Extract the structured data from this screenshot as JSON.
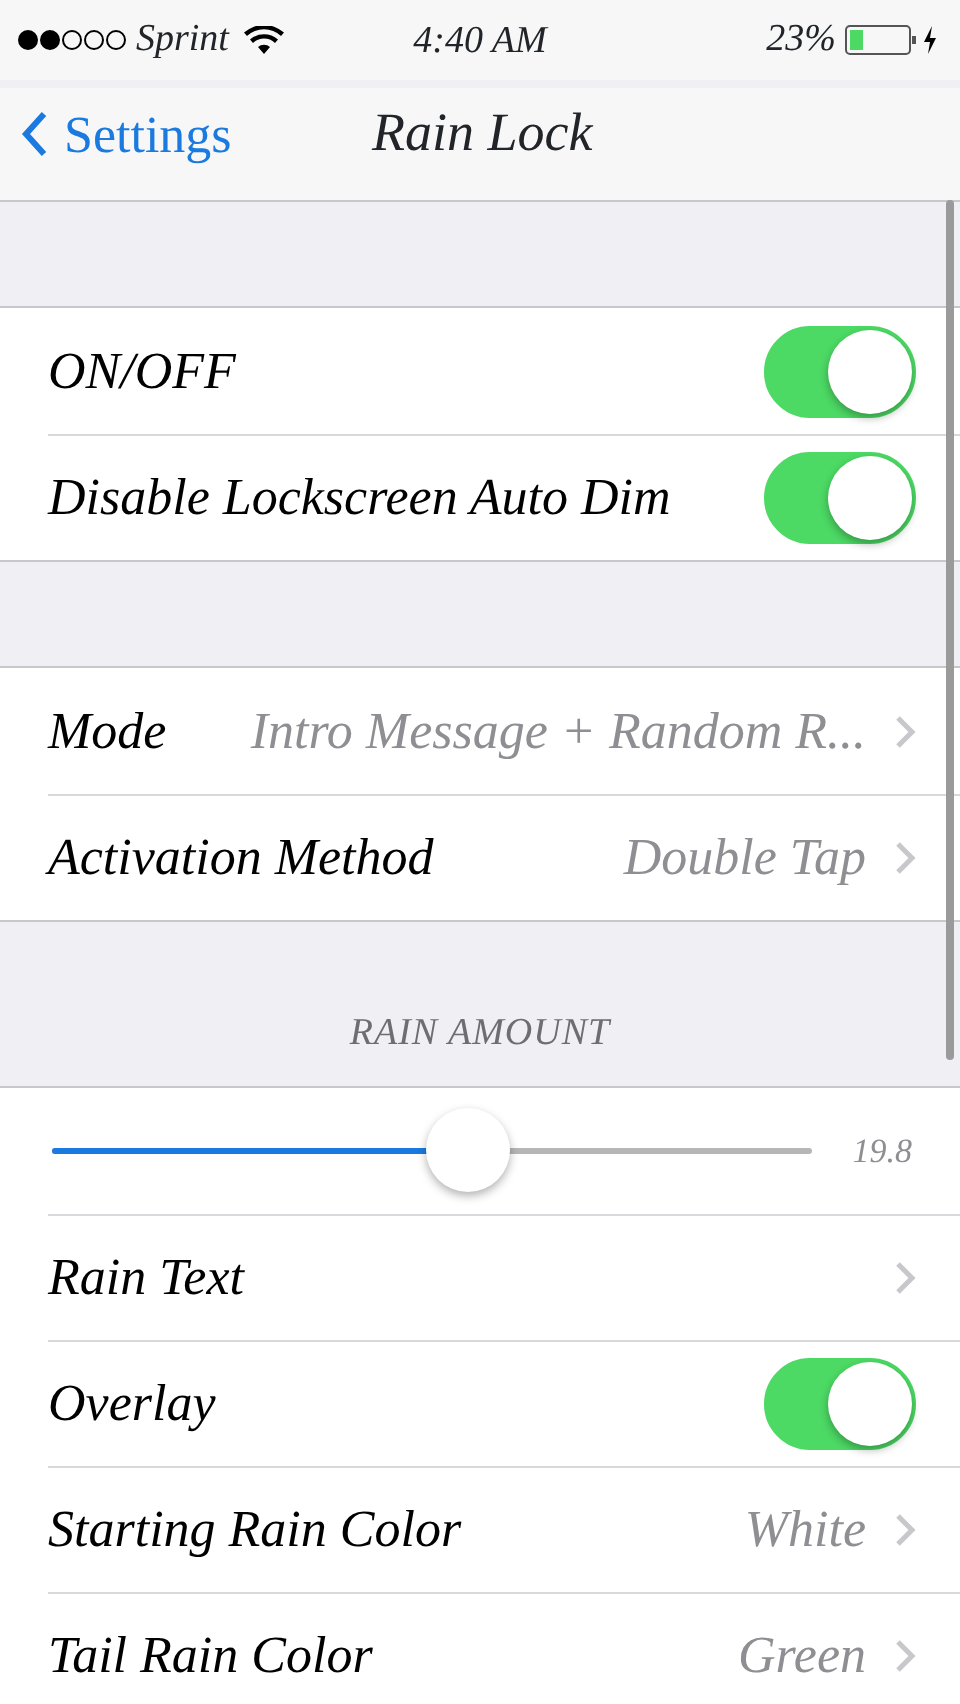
{
  "status_bar": {
    "carrier": "Sprint",
    "time": "4:40 AM",
    "battery": "23%"
  },
  "nav": {
    "back": "Settings",
    "title": "Rain Lock"
  },
  "groups": [
    {
      "rows": [
        {
          "kind": "toggle",
          "label": "ON/OFF",
          "on": true
        },
        {
          "kind": "toggle",
          "label": "Disable Lockscreen Auto Dim",
          "on": true
        }
      ]
    },
    {
      "rows": [
        {
          "kind": "disclosure",
          "label": "Mode",
          "value": "Intro Message + Random R..."
        },
        {
          "kind": "disclosure",
          "label": "Activation Method",
          "value": "Double Tap"
        }
      ]
    },
    {
      "header": "RAIN AMOUNT",
      "rows": [
        {
          "kind": "slider",
          "level": 0.546,
          "reading": "19.8"
        },
        {
          "kind": "disclosure",
          "label": "Rain Text"
        },
        {
          "kind": "toggle",
          "label": "Overlay",
          "on": true
        },
        {
          "kind": "disclosure",
          "label": "Starting Rain Color",
          "value": "White"
        },
        {
          "kind": "disclosure",
          "label": "Tail Rain Color",
          "value": "Green"
        }
      ]
    }
  ]
}
